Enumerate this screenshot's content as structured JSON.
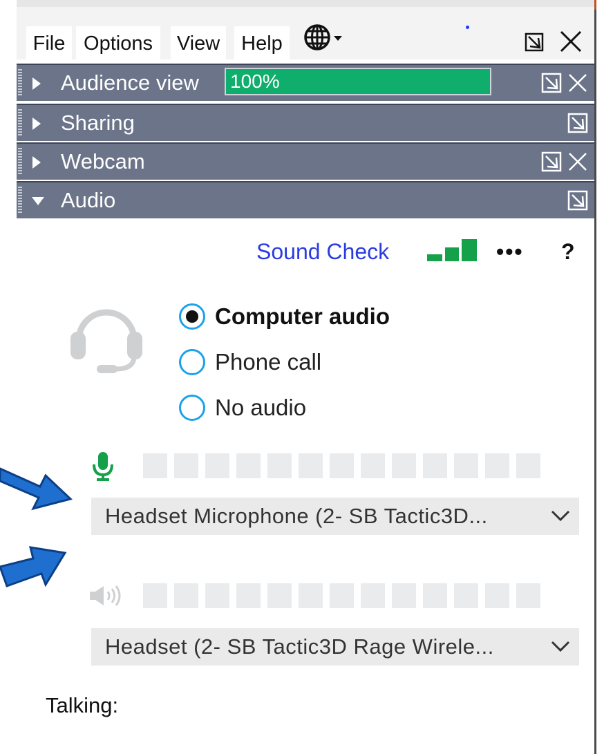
{
  "menubar": {
    "items": [
      "File",
      "Options",
      "View",
      "Help"
    ],
    "icons": [
      "globe-icon",
      "chevron-down-icon",
      "restore-icon",
      "close-icon"
    ]
  },
  "panels": [
    {
      "label": "Audience view",
      "expanded": false,
      "progress_text": "100%",
      "progress": 1.0
    },
    {
      "label": "Sharing",
      "expanded": false
    },
    {
      "label": "Webcam",
      "expanded": false
    },
    {
      "label": "Audio",
      "expanded": true
    }
  ],
  "audio": {
    "sound_check": "Sound Check",
    "more": "•••",
    "help": "?",
    "options": [
      {
        "label": "Computer audio",
        "selected": true
      },
      {
        "label": "Phone call",
        "selected": false
      },
      {
        "label": "No audio",
        "selected": false
      }
    ],
    "mic_level": 0,
    "speaker_level": 0,
    "mic_device": "Headset Microphone (2- SB Tactic3D...",
    "speaker_device": "Headset (2- SB Tactic3D Rage Wirele...",
    "talking_label": "Talking:"
  },
  "colors": {
    "panel_header": "#6b7489",
    "progress_fill": "#0fae6c",
    "radio_ring": "#1aa3e8",
    "link": "#2a3ce0",
    "mic_green": "#15a04a",
    "arrow_blue": "#1e6fd0"
  }
}
